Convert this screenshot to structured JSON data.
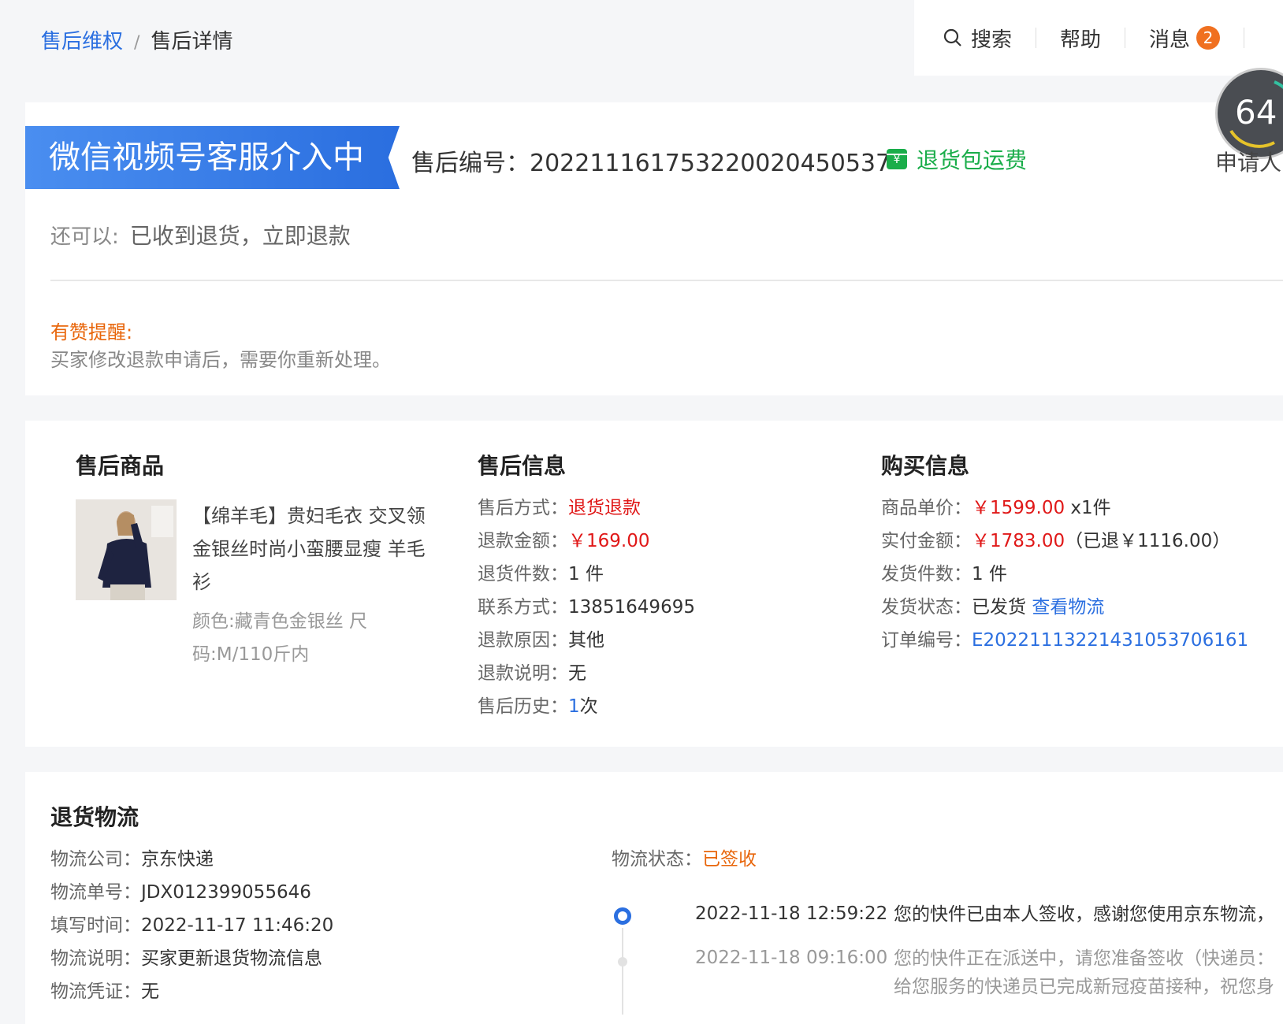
{
  "breadcrumb": {
    "parent": "售后维权",
    "separator": "/",
    "current": "售后详情"
  },
  "topbar": {
    "search": "搜索",
    "help": "帮助",
    "messages": "消息",
    "message_count": "2"
  },
  "dial": {
    "value": "64",
    "label": "申请人"
  },
  "status": {
    "banner": "微信视频号客服介入中",
    "sn_label": "售后编号：",
    "sn": "20221116175322002045​0537",
    "freight": "退货包运费",
    "also_label": "还可以:",
    "also_actions": "已收到退货，立即退款",
    "tip_title": "有赞提醒:",
    "tip_text": "买家修改退款申请后，需要你重新处理。"
  },
  "product": {
    "title": "售后商品",
    "name": "【绵羊毛】贵妇毛衣 交叉领金银丝时尚小蛮腰显瘦 羊毛衫",
    "spec": "颜色:藏青色金银丝 尺码:M/110斤内"
  },
  "aftersale": {
    "title": "售后信息",
    "rows": [
      {
        "k": "售后方式：",
        "v": "退货退款"
      },
      {
        "k": "退款金额：",
        "v": "￥169.00"
      },
      {
        "k": "退货件数：",
        "v": "1 件"
      },
      {
        "k": "联系方式：",
        "v": "13851649695"
      },
      {
        "k": "退款原因：",
        "v": "其他"
      },
      {
        "k": "退款说明：",
        "v": "无"
      },
      {
        "k": "售后历史：",
        "v": "1",
        "v2": "次"
      }
    ]
  },
  "purchase": {
    "title": "购买信息",
    "unit_price_k": "商品单价：",
    "unit_price": "￥1599.00",
    "unit_qty": " x1件",
    "paid_k": "实付金额：",
    "paid": "￥1783.00",
    "paid_refunded": "（已退￥1116.00）",
    "ship_qty_k": "发货件数：",
    "ship_qty": "1 件",
    "ship_status_k": "发货状态：",
    "ship_status": "已发货 ",
    "ship_link": "查看物流",
    "order_no_k": "订单编号：",
    "order_no": "E20221113221431053706161"
  },
  "logistics": {
    "title": "退货物流",
    "rows": [
      {
        "k": "物流公司：",
        "v": "京东快递"
      },
      {
        "k": "物流单号：",
        "v": "JDX012399055646"
      },
      {
        "k": "填写时间：",
        "v": "2022-11-17 11:46:20"
      },
      {
        "k": "物流说明：",
        "v": "买家更新退货物流信息"
      },
      {
        "k": "物流凭证：",
        "v": "无"
      }
    ],
    "status_k": "物流状态：",
    "status_v": "已签收",
    "timeline": [
      {
        "time": "2022-11-18 12:59:22",
        "desc": "您的快件已由本人签收，感谢您使用京东物流，"
      },
      {
        "time": "2022-11-18 09:16:00",
        "desc": "您的快件正在派送中，请您准备签收（快递员：",
        "desc2": "给您服务的快递员已完成新冠疫苗接种，祝您身"
      }
    ]
  },
  "colors": {
    "brand_blue": "#2b6fe0",
    "price_red": "#e01818",
    "status_orange": "#e8650a",
    "freight_green": "#1aad4a"
  }
}
